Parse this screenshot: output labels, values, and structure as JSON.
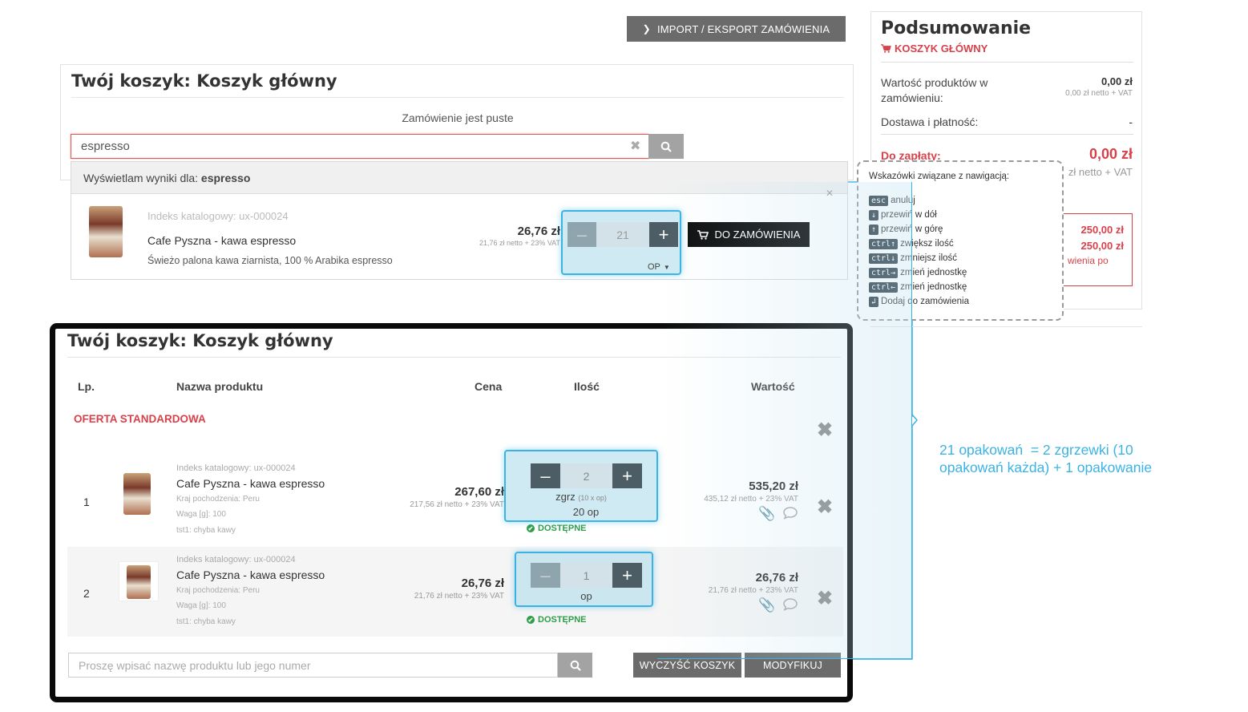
{
  "top_button": {
    "label": "IMPORT / EKSPORT ZAMÓWIENIA"
  },
  "search_card": {
    "title": "Twój koszyk: Koszyk główny",
    "empty_message": "Zamówienie jest puste",
    "search_value": "espresso",
    "results_prefix": "Wyświetlam wyniki dla:",
    "results_term": "espresso",
    "result": {
      "catalog_index": "Indeks katalogowy: ux-000024",
      "name": "Cafe Pyszna - kawa espresso",
      "description": "Świeżo palona kawa ziarnista, 100 % Arabika espresso",
      "price": "26,76 zł",
      "price_net": "21,76 zł netto + 23% VAT",
      "qty": "21",
      "unit": "OP",
      "add_label": "DO ZAMÓWIENIA"
    }
  },
  "summary": {
    "title": "Podsumowanie",
    "cart_link": "KOSZYK GŁÓWNY",
    "products_label": "Wartość produktów w zamówieniu:",
    "products_value": "0,00 zł",
    "products_net": "0,00 zł netto + VAT",
    "delivery_label": "Dostawa i płatność:",
    "delivery_value": "-",
    "to_pay_label": "Do zapłaty:",
    "to_pay_value": "0,00 zł",
    "to_pay_net": "zł netto + VAT",
    "box_value_1": "250,00 zł",
    "box_value_2": "250,00 zł",
    "box_text": "wienia po"
  },
  "hints": {
    "title": "Wskazówki związane z nawigacją:",
    "items": [
      {
        "key": "esc",
        "label": "anuluj"
      },
      {
        "key": "↓",
        "label": "przewiń w dół"
      },
      {
        "key": "↑",
        "label": "przewiń w górę"
      },
      {
        "key": "ctrl↑",
        "label": "zwiększ ilość"
      },
      {
        "key": "ctrl↓",
        "label": "zmniejsz ilość"
      },
      {
        "key": "ctrl→",
        "label": "zmień jednostkę"
      },
      {
        "key": "ctrl←",
        "label": "zmień jednostkę"
      },
      {
        "key": "↲",
        "label": "Dodaj do zamówienia"
      }
    ]
  },
  "cart": {
    "title": "Twój koszyk: Koszyk główny",
    "headers": {
      "lp": "Lp.",
      "name": "Nazwa produktu",
      "price": "Cena",
      "qty": "Ilość",
      "value": "Wartość"
    },
    "section": "OFERTA STANDARDOWA",
    "rows": [
      {
        "lp": "1",
        "catalog_index": "Indeks katalogowy: ux-000024",
        "name": "Cafe Pyszna - kawa espresso",
        "origin": "Kraj pochodzenia: Peru",
        "weight": "Waga [g]: 100",
        "tst": "tst1: chyba kawy",
        "price": "267,60 zł",
        "price_net": "217,56 zł netto + 23% VAT",
        "qty": "2",
        "unit": "zgrz",
        "unit_detail": "(10 x op)",
        "unit_total": "20 op",
        "availability": "DOSTĘPNE",
        "value": "535,20 zł",
        "value_net": "435,12 zł netto + 23% VAT"
      },
      {
        "lp": "2",
        "catalog_index": "Indeks katalogowy: ux-000024",
        "name": "Cafe Pyszna - kawa espresso",
        "origin": "Kraj pochodzenia: Peru",
        "weight": "Waga [g]: 100",
        "tst": "tst1: chyba kawy",
        "price": "26,76 zł",
        "price_net": "21,76 zł netto + 23% VAT",
        "qty": "1",
        "unit": "op",
        "availability": "DOSTĘPNE",
        "value": "26,76 zł",
        "value_net": "21,76 zł netto + 23% VAT"
      }
    ],
    "search_placeholder": "Proszę wpisać nazwę produktu lub jego numer",
    "clear_label": "WYCZYŚĆ KOSZYK",
    "modify_label": "MODYFIKUJ"
  },
  "annotation": {
    "text": "21 opakowań  = 2 zgrzewki (10 opakowań każda) + 1 opakowanie"
  }
}
